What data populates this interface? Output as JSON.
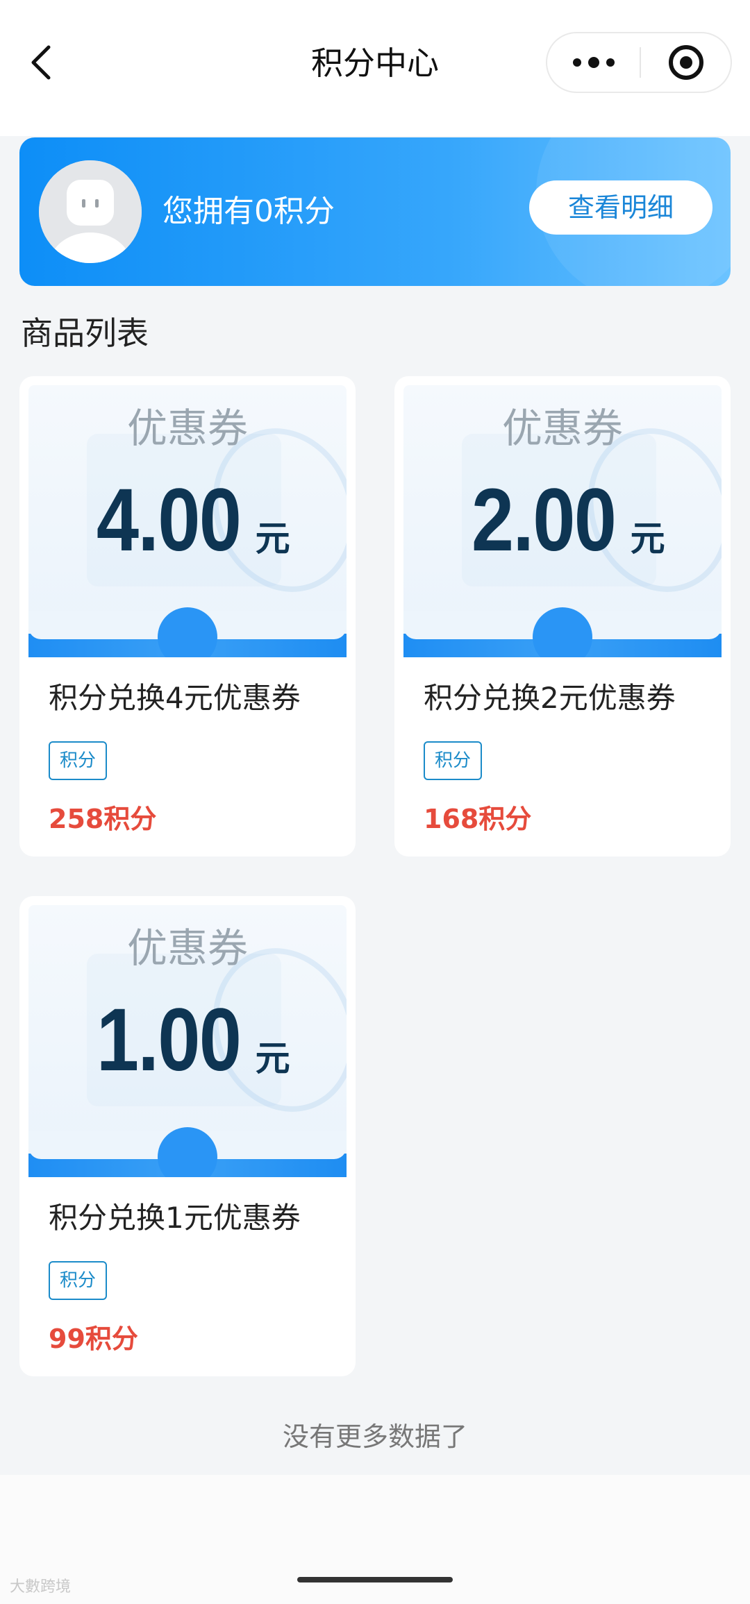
{
  "navbar": {
    "title": "积分中心",
    "back_icon": "chevron-left-icon",
    "more_icon": "more-dots-icon",
    "close_icon": "target-close-icon"
  },
  "banner": {
    "points_text": "您拥有0积分",
    "detail_button": "查看明细",
    "avatar_icon": "robot-avatar-icon"
  },
  "section": {
    "title": "商品列表"
  },
  "products": [
    {
      "coupon_label": "优惠券",
      "amount": "4.00",
      "unit": "元",
      "title": "积分兑换4元优惠券",
      "tag": "积分",
      "price": "258积分"
    },
    {
      "coupon_label": "优惠券",
      "amount": "2.00",
      "unit": "元",
      "title": "积分兑换2元优惠券",
      "tag": "积分",
      "price": "168积分"
    },
    {
      "coupon_label": "优惠券",
      "amount": "1.00",
      "unit": "元",
      "title": "积分兑换1元优惠券",
      "tag": "积分",
      "price": "99积分"
    }
  ],
  "footer": {
    "no_more": "没有更多数据了",
    "watermark": "大數跨境"
  },
  "colors": {
    "accent_blue": "#1a86d8",
    "price_red": "#e64b3c",
    "coupon_amount": "#0e3553"
  }
}
